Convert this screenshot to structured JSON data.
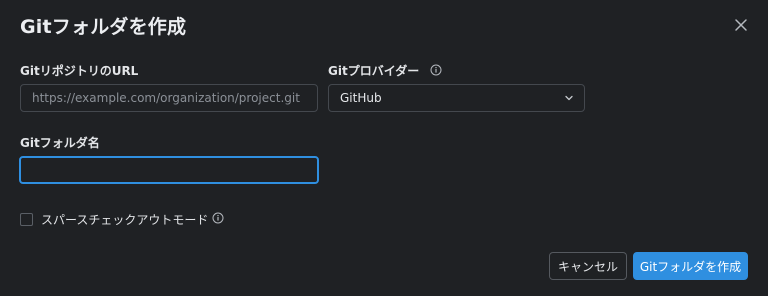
{
  "dialog": {
    "title": "Gitフォルダを作成"
  },
  "fields": {
    "repo_url": {
      "label": "GitリポジトリのURL",
      "placeholder": "https://example.com/organization/project.git",
      "value": ""
    },
    "provider": {
      "label": "Gitプロバイダー",
      "value": "GitHub"
    },
    "folder_name": {
      "label": "Gitフォルダ名",
      "value": ""
    },
    "sparse_checkout": {
      "label": "スパースチェックアウトモード",
      "checked": false
    }
  },
  "buttons": {
    "cancel": "キャンセル",
    "create": "Gitフォルダを作成"
  },
  "colors": {
    "background": "#1f2124",
    "accent": "#2f8fe0",
    "border": "#44484e"
  },
  "icons": {
    "close": "close-icon",
    "info": "info-icon",
    "dropdown": "chevron-down-icon"
  }
}
